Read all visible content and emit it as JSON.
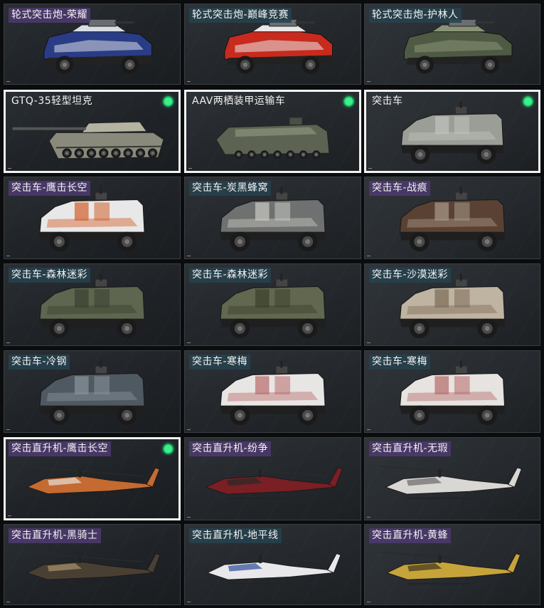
{
  "cards": [
    {
      "label": "轮式突击炮-荣耀",
      "tag": "purple",
      "kind": "apc",
      "body": "#2a3c86",
      "accent": "#d8dde4",
      "equipped": false,
      "selected": false
    },
    {
      "label": "轮式突击炮-巅峰竞赛",
      "tag": "teal",
      "kind": "apc",
      "body": "#c82a1e",
      "accent": "#e8e8e8",
      "equipped": false,
      "selected": false
    },
    {
      "label": "轮式突击炮-护林人",
      "tag": "teal",
      "kind": "apc",
      "body": "#4f5a44",
      "accent": "#8a9378",
      "equipped": false,
      "selected": false
    },
    {
      "label": "GTQ-35轻型坦克",
      "tag": "plain",
      "kind": "tank",
      "body": "#8a8a7c",
      "accent": "#b4b3a2",
      "equipped": true,
      "selected": true
    },
    {
      "label": "AAV两栖装甲运输车",
      "tag": "plain",
      "kind": "aav",
      "body": "#5c6352",
      "accent": "#7d846f",
      "equipped": true,
      "selected": true
    },
    {
      "label": "突击车",
      "tag": "plain",
      "kind": "mrap",
      "body": "#9a9e97",
      "accent": "#c0c3bd",
      "equipped": true,
      "selected": true
    },
    {
      "label": "突击车-鹰击长空",
      "tag": "purple",
      "kind": "mrap",
      "body": "#e8e8e8",
      "accent": "#d2602a",
      "equipped": false,
      "selected": false
    },
    {
      "label": "突击车-炭黑蜂窝",
      "tag": "teal",
      "kind": "mrap",
      "body": "#6e7170",
      "accent": "#c9c9c4",
      "equipped": false,
      "selected": false
    },
    {
      "label": "突击车-战痕",
      "tag": "purple",
      "kind": "mrap",
      "body": "#5a4134",
      "accent": "#a89a8a",
      "equipped": false,
      "selected": false
    },
    {
      "label": "突击车-森林迷彩",
      "tag": "teal",
      "kind": "mrap",
      "body": "#5e6650",
      "accent": "#39402f",
      "equipped": false,
      "selected": false
    },
    {
      "label": "突击车-森林迷彩",
      "tag": "teal",
      "kind": "mrap",
      "body": "#62684f",
      "accent": "#3a3f2c",
      "equipped": false,
      "selected": false
    },
    {
      "label": "突击车-沙漠迷彩",
      "tag": "teal",
      "kind": "mrap",
      "body": "#bfb4a1",
      "accent": "#7c6b57",
      "equipped": false,
      "selected": false
    },
    {
      "label": "突击车-冷钢",
      "tag": "teal",
      "kind": "mrap",
      "body": "#4f5962",
      "accent": "#8a949c",
      "equipped": false,
      "selected": false
    },
    {
      "label": "突击车-寒梅",
      "tag": "teal",
      "kind": "mrap",
      "body": "#e8e6e4",
      "accent": "#b76b6b",
      "equipped": false,
      "selected": false
    },
    {
      "label": "突击车-寒梅",
      "tag": "teal",
      "kind": "mrap",
      "body": "#e6e3e0",
      "accent": "#b56a6a",
      "equipped": false,
      "selected": false
    },
    {
      "label": "突击直升机-鹰击长空",
      "tag": "purple",
      "kind": "heli",
      "body": "#c56a30",
      "accent": "#e5e1da",
      "equipped": true,
      "selected": true
    },
    {
      "label": "突击直升机-纷争",
      "tag": "purple",
      "kind": "heli",
      "body": "#7a1f24",
      "accent": "#2a2a2a",
      "equipped": false,
      "selected": false
    },
    {
      "label": "突击直升机-无瑕",
      "tag": "purple",
      "kind": "heli",
      "body": "#d9d7d3",
      "accent": "#6a6a6a",
      "equipped": false,
      "selected": false
    },
    {
      "label": "突击直升机-黑骑士",
      "tag": "purple",
      "kind": "heli",
      "body": "#4a3f33",
      "accent": "#a8916c",
      "equipped": false,
      "selected": false
    },
    {
      "label": "突击直升机-地平线",
      "tag": "teal",
      "kind": "heli",
      "body": "#e8e8ea",
      "accent": "#2e4f9a",
      "equipped": false,
      "selected": false
    },
    {
      "label": "突击直升机-黄蜂",
      "tag": "purple",
      "kind": "heli",
      "body": "#c7a43a",
      "accent": "#3d3420",
      "equipped": false,
      "selected": false
    }
  ]
}
